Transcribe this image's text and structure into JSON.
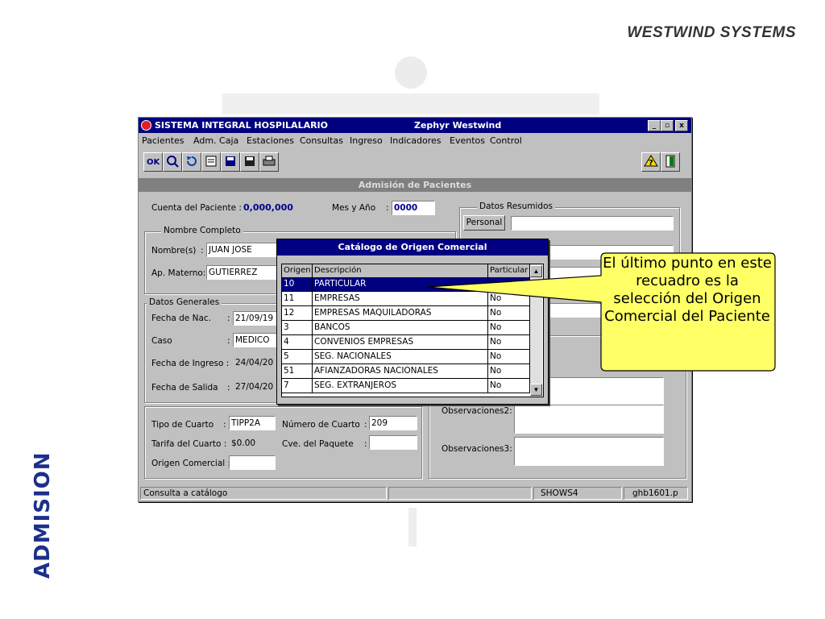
{
  "brand": "WESTWIND  SYSTEMS",
  "vertical_label": "ADMISION",
  "window": {
    "title": "SISTEMA INTEGRAL HOSPILALARIO",
    "subtitle": "Zephyr Westwind",
    "controls": [
      "_",
      "▫",
      "x"
    ],
    "menu": [
      "Pacientes",
      "Adm. Caja",
      "Estaciones",
      "Consultas",
      "Ingreso",
      "Indicadores",
      "Eventos",
      "Control"
    ],
    "toolbar": [
      "ok-icon",
      "search-icon",
      "undo-icon",
      "print-preview-icon",
      "save-icon",
      "save-disk-icon",
      "printer-icon"
    ],
    "section_title": "Admisión de Pacientes"
  },
  "form": {
    "cuenta_label": "Cuenta del Paciente :",
    "cuenta_value": "0,000,000",
    "mes_label": "Mes y Año",
    "mes_colon": ":",
    "mes_value": "0000",
    "datos_resumidos": "Datos Resumidos",
    "personal_btn": "Personal",
    "nombre_completo": "Nombre Completo",
    "nombre_label": "Nombre(s)",
    "nombre_colon": ":",
    "nombre_value": "JUAN JOSE",
    "materno_label": "Ap. Materno:",
    "materno_value": "GUTIERREZ",
    "datos_generales": "Datos Generales",
    "nac_label": "Fecha  de  Nac.",
    "nac_value": "21/09/19",
    "caso_label": "Caso",
    "caso_value": "MEDICO",
    "ingreso_label": "Fecha de Ingreso :",
    "ingreso_value": "24/04/20",
    "salida_label": "Fecha de Salida",
    "salida_value": "27/04/20",
    "tipo_cuarto_label": "Tipo de Cuarto",
    "tipo_cuarto_value": "TIPP2A",
    "num_cuarto_label": "Número de Cuarto",
    "num_cuarto_value": "209",
    "tarifa_label": "Tarifa del Cuarto :",
    "tarifa_value": "$0.00",
    "paquete_label": "Cve. del Paquete",
    "origen_label": "Origen Comercial :",
    "obs2_label": "Observaciones2:",
    "obs3_label": "Observaciones3:",
    "colon": ":"
  },
  "catalog": {
    "title": "Catálogo de Origen Comercial",
    "headers": [
      "Origen",
      "Descripción",
      "Particular"
    ],
    "rows": [
      {
        "origen": "10",
        "descripcion": "PARTICULAR",
        "particular": ""
      },
      {
        "origen": "11",
        "descripcion": "EMPRESAS",
        "particular": "No"
      },
      {
        "origen": "12",
        "descripcion": "EMPRESAS MAQUILADORAS",
        "particular": "No"
      },
      {
        "origen": "3",
        "descripcion": "BANCOS",
        "particular": "No"
      },
      {
        "origen": "4",
        "descripcion": "CONVENIOS EMPRESAS",
        "particular": "No"
      },
      {
        "origen": "5",
        "descripcion": "SEG. NACIONALES",
        "particular": "No"
      },
      {
        "origen": "51",
        "descripcion": "AFIANZADORAS NACIONALES",
        "particular": "No"
      },
      {
        "origen": "7",
        "descripcion": "SEG. EXTRANJEROS",
        "particular": "No"
      }
    ]
  },
  "statusbar": {
    "message": "Consulta a catálogo",
    "center": "",
    "station": "SHOWS4",
    "program": "ghb1601.p"
  },
  "callout": "El último punto en este recuadro es la selección del Origen Comercial del Paciente",
  "colors": {
    "callout_fill": "#ffff66",
    "title_bar": "#000080",
    "window_face": "#c0c0c0",
    "accent_blue": "#1c2f8c"
  }
}
